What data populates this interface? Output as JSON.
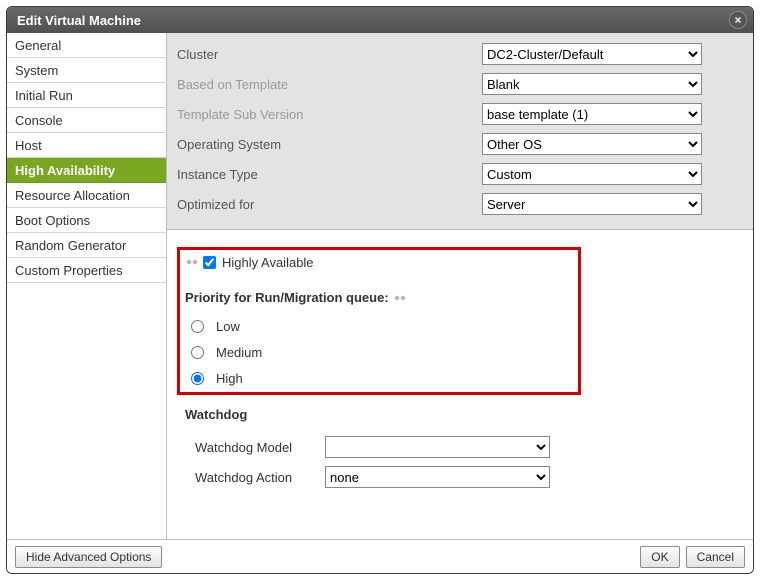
{
  "dialog": {
    "title": "Edit Virtual Machine"
  },
  "sidebar": {
    "items": [
      {
        "label": "General"
      },
      {
        "label": "System"
      },
      {
        "label": "Initial Run"
      },
      {
        "label": "Console"
      },
      {
        "label": "Host"
      },
      {
        "label": "High Availability",
        "active": true
      },
      {
        "label": "Resource Allocation"
      },
      {
        "label": "Boot Options"
      },
      {
        "label": "Random Generator"
      },
      {
        "label": "Custom Properties"
      }
    ]
  },
  "upper": {
    "cluster": {
      "label": "Cluster",
      "value": "DC2-Cluster/Default"
    },
    "template": {
      "label": "Based on Template",
      "value": "Blank"
    },
    "templateSub": {
      "label": "Template Sub Version",
      "value": "base template (1)"
    },
    "os": {
      "label": "Operating System",
      "value": "Other OS"
    },
    "instance": {
      "label": "Instance Type",
      "value": "Custom"
    },
    "optimized": {
      "label": "Optimized for",
      "value": "Server"
    }
  },
  "ha": {
    "highlyAvailableLabel": "Highly Available",
    "highlyAvailableChecked": true,
    "priorityHeading": "Priority for Run/Migration queue:",
    "priorities": {
      "low": "Low",
      "medium": "Medium",
      "high": "High",
      "selected": "high"
    },
    "watchdogHeading": "Watchdog",
    "watchdogModelLabel": "Watchdog Model",
    "watchdogModelValue": "",
    "watchdogActionLabel": "Watchdog Action",
    "watchdogActionValue": "none"
  },
  "footer": {
    "hideAdvanced": "Hide Advanced Options",
    "ok": "OK",
    "cancel": "Cancel"
  }
}
